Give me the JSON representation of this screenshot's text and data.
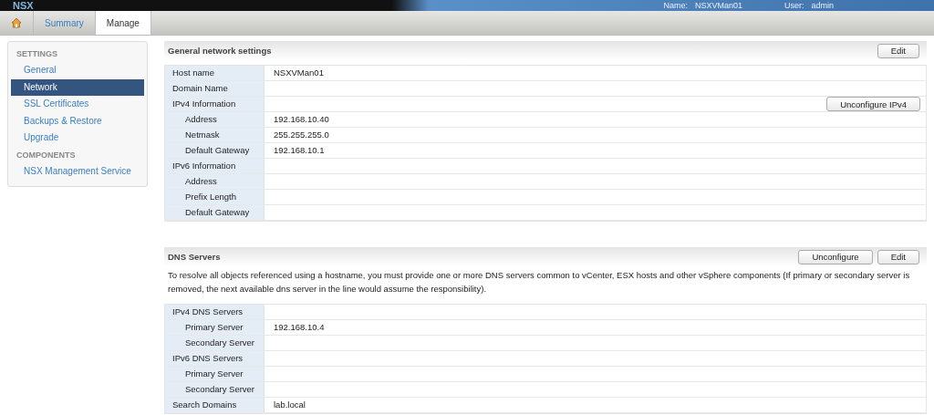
{
  "header": {
    "logo": "NSX",
    "name_label": "Name:",
    "name_value": "NSXVMan01",
    "user_label": "User:",
    "user_value": "admin"
  },
  "tabs": [
    {
      "kind": "home",
      "selected": false
    },
    {
      "kind": "text",
      "label": "Summary",
      "selected": false
    },
    {
      "kind": "text",
      "label": "Manage",
      "selected": true
    }
  ],
  "sidebar": {
    "sections": [
      {
        "title": "SETTINGS",
        "items": [
          {
            "label": "General",
            "selected": false
          },
          {
            "label": "Network",
            "selected": true
          },
          {
            "label": "SSL Certificates",
            "selected": false
          },
          {
            "label": "Backups & Restore",
            "selected": false
          },
          {
            "label": "Upgrade",
            "selected": false
          }
        ]
      },
      {
        "title": "COMPONENTS",
        "items": [
          {
            "label": "NSX Management Service",
            "selected": false
          }
        ]
      }
    ]
  },
  "sections": [
    {
      "title": "General network settings",
      "buttons": [
        "Edit"
      ],
      "rows": [
        {
          "kind": "group",
          "label": "Host name",
          "value": "NSXVMan01"
        },
        {
          "kind": "group",
          "label": "Domain Name",
          "value": ""
        },
        {
          "kind": "group",
          "label": "IPv4 Information",
          "value": "",
          "action": "Unconfigure IPv4"
        },
        {
          "kind": "sub",
          "label": "Address",
          "value": "192.168.10.40"
        },
        {
          "kind": "sub",
          "label": "Netmask",
          "value": "255.255.255.0"
        },
        {
          "kind": "sub",
          "label": "Default Gateway",
          "value": "192.168.10.1"
        },
        {
          "kind": "group",
          "label": "IPv6 Information",
          "value": ""
        },
        {
          "kind": "sub",
          "label": "Address",
          "value": ""
        },
        {
          "kind": "sub",
          "label": "Prefix Length",
          "value": ""
        },
        {
          "kind": "sub",
          "label": "Default Gateway",
          "value": ""
        }
      ]
    },
    {
      "title": "DNS Servers",
      "buttons": [
        "Unconfigure",
        "Edit"
      ],
      "description": "To resolve all objects referenced using a hostname, you must provide one or more DNS servers common to vCenter, ESX hosts and other vSphere components (If primary or secondary server is removed, the next available dns server in the line would assume the responsibility).",
      "rows": [
        {
          "kind": "group",
          "label": "IPv4 DNS Servers",
          "value": ""
        },
        {
          "kind": "sub",
          "label": "Primary Server",
          "value": "192.168.10.4"
        },
        {
          "kind": "sub",
          "label": "Secondary Server",
          "value": ""
        },
        {
          "kind": "group",
          "label": "IPv6 DNS Servers",
          "value": ""
        },
        {
          "kind": "sub",
          "label": "Primary Server",
          "value": ""
        },
        {
          "kind": "sub",
          "label": "Secondary Server",
          "value": ""
        },
        {
          "kind": "group",
          "label": "Search Domains",
          "value": "lab.local"
        }
      ]
    }
  ]
}
